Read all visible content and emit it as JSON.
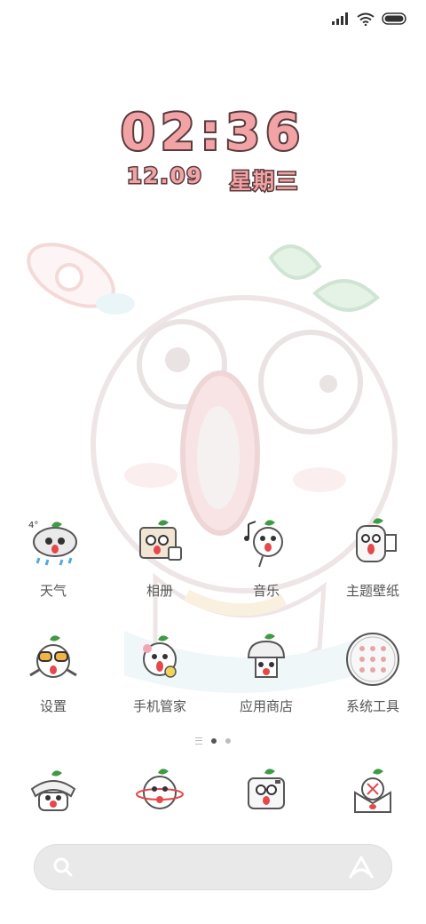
{
  "status_bar": {
    "icons": [
      "signal-icon",
      "wifi-icon",
      "battery-icon"
    ]
  },
  "clock": {
    "time": "02:36",
    "date": "12.09",
    "weekday": "星期三"
  },
  "apps": [
    {
      "label": "天气",
      "icon": "weather-icon",
      "badge": "4°"
    },
    {
      "label": "相册",
      "icon": "gallery-icon"
    },
    {
      "label": "音乐",
      "icon": "music-icon"
    },
    {
      "label": "主题壁纸",
      "icon": "theme-wallpaper-icon"
    },
    {
      "label": "设置",
      "icon": "settings-icon"
    },
    {
      "label": "手机管家",
      "icon": "security-icon"
    },
    {
      "label": "应用商店",
      "icon": "app-store-icon"
    },
    {
      "label": "系统工具",
      "icon": "system-tools-folder-icon"
    }
  ],
  "dock": [
    {
      "icon": "phone-icon"
    },
    {
      "icon": "browser-icon"
    },
    {
      "icon": "camera-icon"
    },
    {
      "icon": "messages-icon"
    }
  ],
  "page_indicator": {
    "current": 1,
    "count": 2
  },
  "search": {
    "placeholder": ""
  },
  "colors": {
    "accent_pink": "#f2a3a6",
    "outline": "#5a3b3d",
    "leaf_green": "#3f9a45"
  }
}
